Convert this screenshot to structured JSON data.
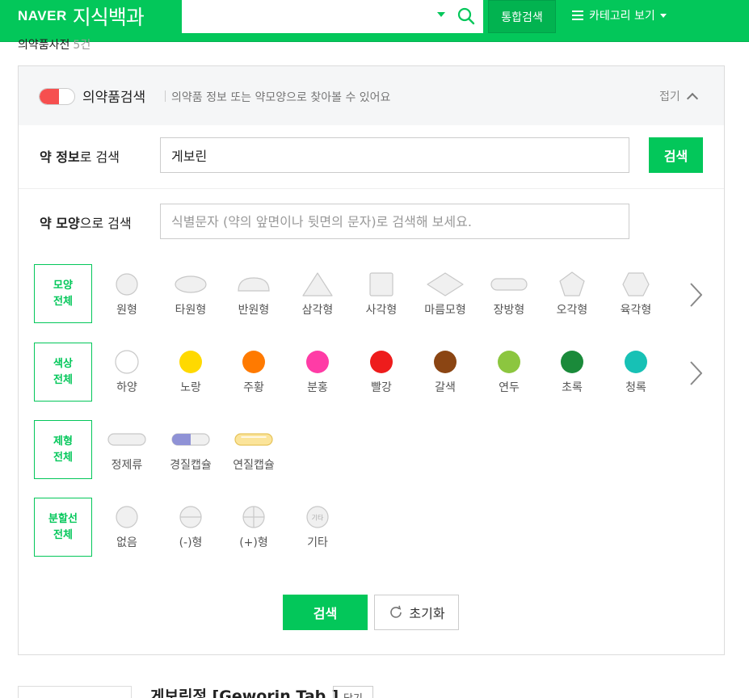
{
  "header": {
    "logo_brand": "NAVER",
    "logo_service": "지식백과",
    "search_value": "",
    "total_search": "통합검색",
    "category": "카테고리 보기"
  },
  "crumb": {
    "title": "의약품사전",
    "count": "5건"
  },
  "panel": {
    "title": "의약품검색",
    "desc": "의약품 정보 또는 약모양으로 찾아볼 수 있어요",
    "fold": "접기",
    "info_label_bold": "약 정보",
    "info_label_rest": "로 검색",
    "info_value": "게보린",
    "search_btn": "검색",
    "shape_label_bold": "약 모양",
    "shape_label_rest": "으로 검색",
    "shape_placeholder": "식별문자 (약의 앞면이나 뒷면의 문자)로 검색해 보세요."
  },
  "filters": {
    "shape": {
      "label1": "모양",
      "label2": "전체",
      "options": [
        "원형",
        "타원형",
        "반원형",
        "삼각형",
        "사각형",
        "마름모형",
        "장방형",
        "오각형",
        "육각형"
      ]
    },
    "color": {
      "label1": "색상",
      "label2": "전체",
      "options": [
        "하양",
        "노랑",
        "주황",
        "분홍",
        "빨강",
        "갈색",
        "연두",
        "초록",
        "청록"
      ],
      "colors": [
        "#ffffff",
        "#ffd900",
        "#ff7a00",
        "#ff3ca6",
        "#ee1c1c",
        "#8b4513",
        "#8cc63f",
        "#1a8a3a",
        "#17c1b5"
      ]
    },
    "form": {
      "label1": "제형",
      "label2": "전체",
      "options": [
        "정제류",
        "경질캡슐",
        "연질캡슐"
      ]
    },
    "split": {
      "label1": "분할선",
      "label2": "전체",
      "options": [
        "없음",
        "(-)형",
        "(+)형",
        "기타"
      ],
      "etc_mark": "기타"
    }
  },
  "bottom": {
    "search": "검색",
    "reset": "초기화"
  },
  "result": {
    "title": "게보린정 [Geworin Tab.]",
    "close": "닫기"
  }
}
